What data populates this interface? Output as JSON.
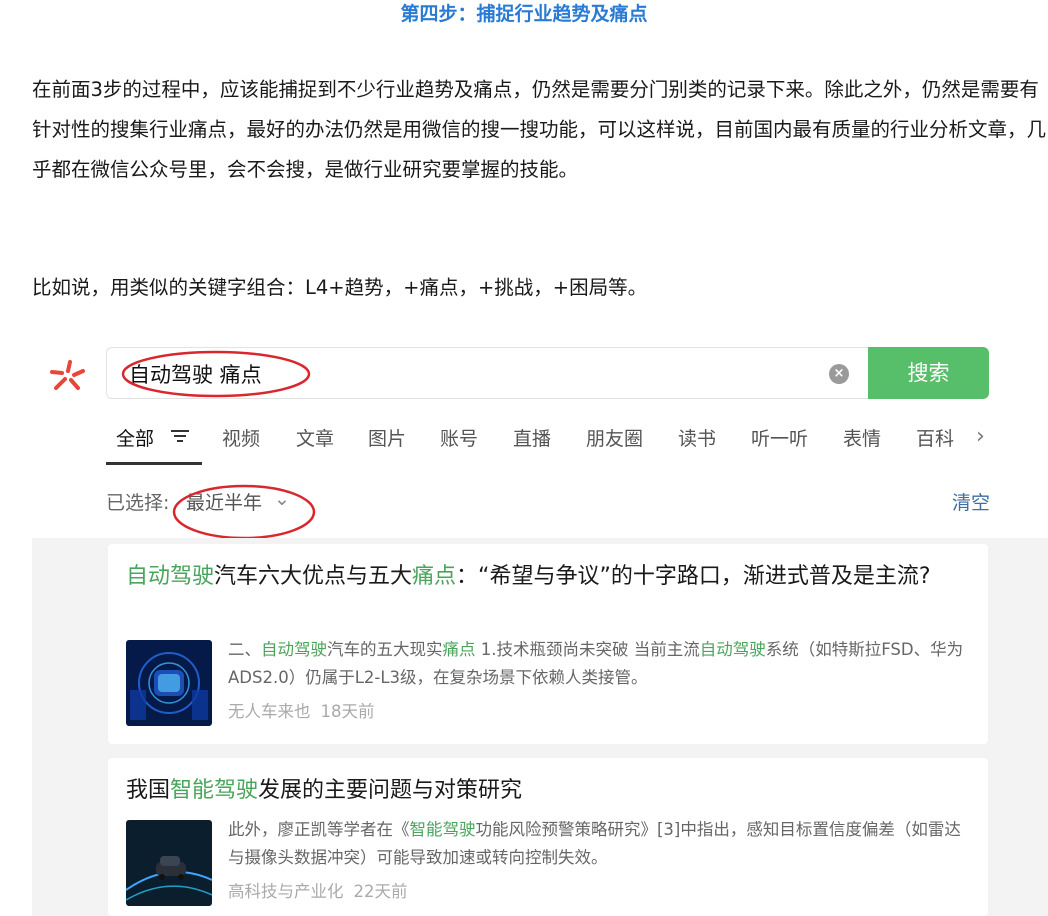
{
  "article": {
    "step_title": "第四步：捕捉行业趋势及痛点",
    "paragraph1": "在前面3步的过程中，应该能捕捉到不少行业趋势及痛点，仍然是需要分门别类的记录下来。除此之外，仍然是需要有针对性的搜集行业痛点，最好的办法仍然是用微信的搜一搜功能，可以这样说，目前国内最有质量的行业分析文章，几乎都在微信公众号里，会不会搜，是做行业研究要掌握的技能。",
    "paragraph2": "比如说，用类似的关键字组合：L4+趋势，+痛点，+挑战，+困局等。"
  },
  "search": {
    "query": "自动驾驶 痛点",
    "clear_icon": "×",
    "button_label": "搜索"
  },
  "tabs": [
    "全部",
    "视频",
    "文章",
    "图片",
    "账号",
    "直播",
    "朋友圈",
    "读书",
    "听一听",
    "表情",
    "百科"
  ],
  "tabs_more": "›",
  "filter": {
    "label": "已选择:",
    "value": "最近半年",
    "chevron": "⌄",
    "clear_label": "清空"
  },
  "results": [
    {
      "title_parts": [
        {
          "text": "自动驾驶",
          "hl": true
        },
        {
          "text": "汽车六大优点与五大",
          "hl": false
        },
        {
          "text": "痛点",
          "hl": true
        },
        {
          "text": "：“希望与争议”的十字路口，渐进式普及是主流?",
          "hl": false
        }
      ],
      "snippet_parts": [
        {
          "text": "二、",
          "hl": false
        },
        {
          "text": "自动驾驶",
          "hl": true
        },
        {
          "text": "汽车的五大现实",
          "hl": false
        },
        {
          "text": "痛点",
          "hl": true
        },
        {
          "text": " 1.技术瓶颈尚未突破 当前主流",
          "hl": false
        },
        {
          "text": "自动驾驶",
          "hl": true
        },
        {
          "text": "系统（如特斯拉FSD、华为ADS2.0）仍属于L2-L3级，在复杂场景下依赖人类接管。",
          "hl": false
        }
      ],
      "source": "无人车来也",
      "time": "18天前"
    },
    {
      "title_parts": [
        {
          "text": "我国",
          "hl": false
        },
        {
          "text": "智能驾驶",
          "hl": true
        },
        {
          "text": "发展的主要问题与对策研究",
          "hl": false
        }
      ],
      "snippet_parts": [
        {
          "text": "此外，廖正凯等学者在《",
          "hl": false
        },
        {
          "text": "智能驾驶",
          "hl": true
        },
        {
          "text": "功能风险预警策略研究》[3]中指出，感知目标置信度偏差（如雷达与摄像头数据冲突）可能导致加速或转向控制失效。",
          "hl": false
        }
      ],
      "source": "高科技与产业化",
      "time": "22天前"
    }
  ],
  "colors": {
    "accent_blue": "#2a7bd3",
    "search_green": "#57be6a",
    "highlight_green": "#4aa55c",
    "annotation_red": "#d9272e",
    "logo_red": "#e8463b"
  }
}
